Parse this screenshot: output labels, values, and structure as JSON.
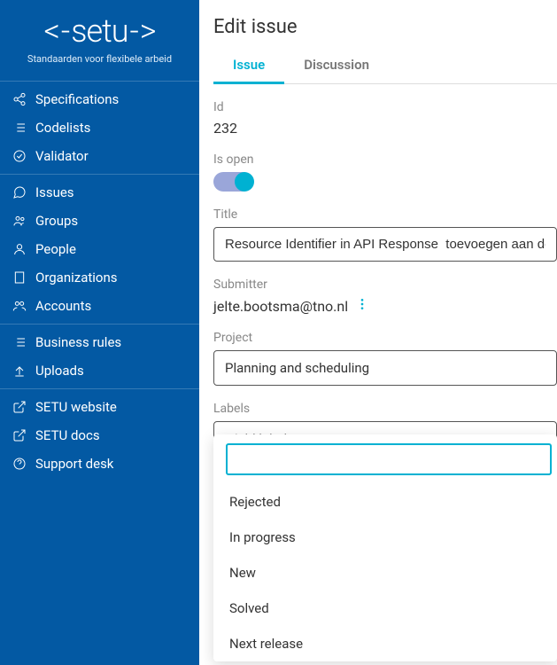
{
  "brand": {
    "name": "setu",
    "tagline": "Standaarden voor flexibele arbeid"
  },
  "sidebar": {
    "sections": [
      {
        "items": [
          {
            "label": "Specifications",
            "icon": "share"
          },
          {
            "label": "Codelists",
            "icon": "list"
          },
          {
            "label": "Validator",
            "icon": "check-circle"
          }
        ]
      },
      {
        "items": [
          {
            "label": "Issues",
            "icon": "chat"
          },
          {
            "label": "Groups",
            "icon": "groups"
          },
          {
            "label": "People",
            "icon": "person"
          },
          {
            "label": "Organizations",
            "icon": "building"
          },
          {
            "label": "Accounts",
            "icon": "accounts"
          }
        ]
      },
      {
        "items": [
          {
            "label": "Business rules",
            "icon": "list"
          },
          {
            "label": "Uploads",
            "icon": "upload"
          }
        ]
      },
      {
        "items": [
          {
            "label": "SETU website",
            "icon": "external"
          },
          {
            "label": "SETU docs",
            "icon": "external"
          },
          {
            "label": "Support desk",
            "icon": "help"
          }
        ]
      }
    ]
  },
  "page": {
    "title": "Edit issue",
    "tabs": [
      {
        "label": "Issue",
        "active": true
      },
      {
        "label": "Discussion",
        "active": false
      }
    ],
    "fields": {
      "id_label": "Id",
      "id_value": "232",
      "isopen_label": "Is open",
      "isopen_value": true,
      "title_label": "Title",
      "title_value": "Resource Identifier in API Response  toevoegen aan de ",
      "submitter_label": "Submitter",
      "submitter_value": "jelte.bootsma@tno.nl",
      "project_label": "Project",
      "project_value": "Planning and scheduling",
      "labels_label": "Labels",
      "labels_placeholder": "- Add label -"
    },
    "dropdown": {
      "options": [
        "Rejected",
        "In progress",
        "New",
        "Solved",
        "Next release"
      ]
    }
  }
}
